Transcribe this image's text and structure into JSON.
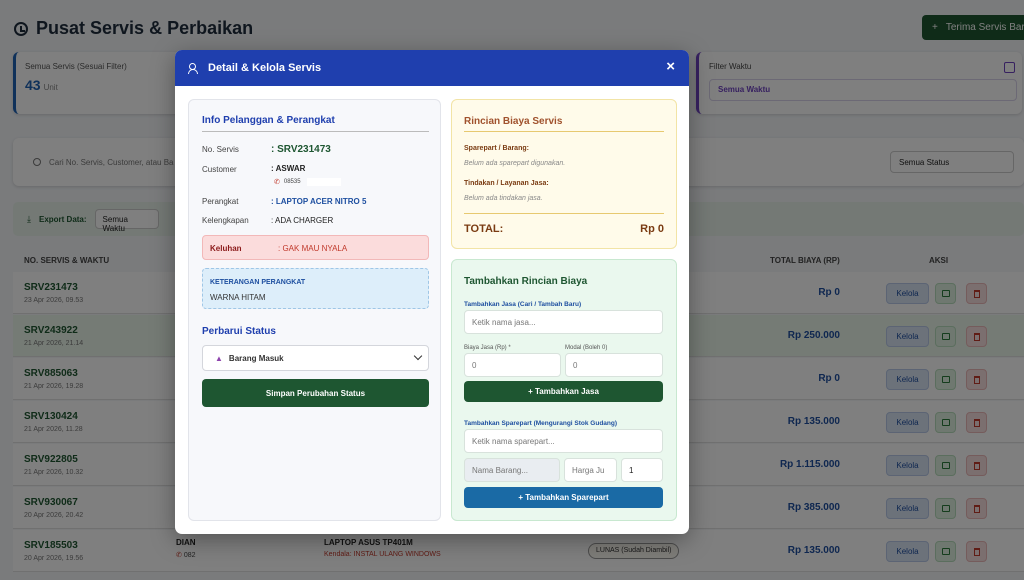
{
  "page": {
    "title": "Pusat Servis & Perbaikan",
    "new_button": "Terima Servis Baru",
    "new_button_icon": "+"
  },
  "stat": {
    "label": "Semua Servis (Sesuai Filter)",
    "value": "43",
    "unit": "Unit"
  },
  "time_filter": {
    "label": "Filter Waktu",
    "value": "Semua Waktu"
  },
  "search": {
    "placeholder": "Cari No. Servis, Customer, atau Ba"
  },
  "status_filter": {
    "value": "Semua Status"
  },
  "export": {
    "label": "Export Data:",
    "value": "Semua Waktu"
  },
  "table": {
    "headers": {
      "id": "NO. SERVIS & WAKTU",
      "total": "TOTAL BIAYA (RP)",
      "action": "AKSI"
    },
    "kelola_label": "Kelola",
    "rows": [
      {
        "id": "SRV231473",
        "date": "23 Apr 2026, 09.53",
        "total": "Rp 0"
      },
      {
        "id": "SRV243922",
        "date": "21 Apr 2026, 21.14",
        "total": "Rp 250.000"
      },
      {
        "id": "SRV885063",
        "date": "21 Apr 2026, 19.28",
        "total": "Rp 0"
      },
      {
        "id": "SRV130424",
        "date": "21 Apr 2026, 11.28",
        "total": "Rp 135.000"
      },
      {
        "id": "SRV922805",
        "date": "21 Apr 2026, 10.32",
        "total": "Rp 1.115.000"
      },
      {
        "id": "SRV930067",
        "date": "20 Apr 2026, 20.42",
        "total": "Rp 385.000"
      },
      {
        "id": "SRV185503",
        "date": "20 Apr 2026, 19.56",
        "total": "Rp 135.000",
        "customer": "DIAN",
        "phone": "082",
        "device": "LAPTOP ASUS TP401M",
        "issue": "Kendala: INSTAL ULANG WINDOWS",
        "status": "LUNAS (Sudah Diambil)"
      }
    ]
  },
  "modal": {
    "title": "Detail & Kelola Servis",
    "close": "×",
    "info": {
      "title": "Info Pelanggan & Perangkat",
      "service_no_label": "No. Servis",
      "service_no": ": SRV231473",
      "customer_label": "Customer",
      "customer": ": ASWAR",
      "phone": "08535",
      "device_label": "Perangkat",
      "device": ": LAPTOP ACER NITRO 5",
      "accessories_label": "Kelengkapan",
      "accessories": ": ADA CHARGER",
      "complaint_label": "Keluhan",
      "complaint": ": GAK MAU NYALA",
      "note_title": "KETERANGAN PERANGKAT",
      "note_value": "WARNA HITAM"
    },
    "status": {
      "title": "Perbarui Status",
      "selected": "Barang Masuk",
      "save_button": "Simpan Perubahan Status"
    },
    "cost": {
      "title": "Rincian Biaya Servis",
      "parts_label": "Sparepart / Barang:",
      "parts_empty": "Belum ada sparepart digunakan.",
      "services_label": "Tindakan / Layanan Jasa:",
      "services_empty": "Belum ada tindakan jasa.",
      "total_label": "TOTAL:",
      "total_value": "Rp 0"
    },
    "add": {
      "title": "Tambahkan Rincian Biaya",
      "service_label": "Tambahkan Jasa (Cari / Tambah Baru)",
      "service_placeholder": "Ketik nama jasa...",
      "fee_label": "Biaya Jasa (Rp) *",
      "fee_value": "0",
      "capital_label": "Modal (Boleh 0)",
      "capital_value": "0",
      "add_service_button": "+ Tambahkan Jasa",
      "part_label": "Tambahkan Sparepart (Mengurangi Stok Gudang)",
      "part_placeholder": "Ketik nama sparepart...",
      "part_name_placeholder": "Nama Barang...",
      "part_price_placeholder": "Harga Ju",
      "part_qty": "1",
      "add_part_button": "+ Tambahkan Sparepart"
    }
  },
  "colors": {
    "primary": "#1f3fae",
    "success": "#1e5631",
    "info": "#1a6aa5",
    "danger": "#c0392b"
  }
}
